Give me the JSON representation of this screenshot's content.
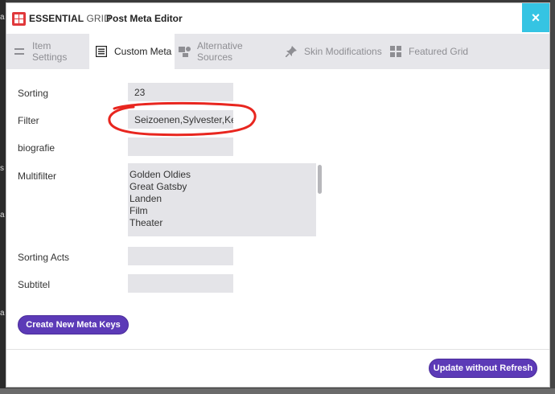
{
  "background": {
    "left_letters": [
      "a",
      "s",
      "a",
      "a"
    ]
  },
  "header": {
    "logo_bold": "ESSENTIAL",
    "logo_light": "GRID",
    "title": "Post Meta Editor",
    "close_symbol": "×"
  },
  "tabs": [
    {
      "label": "Item Settings",
      "icon": "sliders-icon",
      "active": false
    },
    {
      "label": "Custom Meta",
      "icon": "list-icon",
      "active": true
    },
    {
      "label": "Alternative Sources",
      "icon": "media-icon",
      "active": false
    },
    {
      "label": "Skin Modifications",
      "icon": "pin-icon",
      "active": false
    },
    {
      "label": "Featured Grid",
      "icon": "grid-icon",
      "active": false
    }
  ],
  "form": {
    "sorting": {
      "label": "Sorting",
      "value": "23"
    },
    "filter": {
      "label": "Filter",
      "value": "Seizoenen,Sylvester,Kerstmis"
    },
    "biografie": {
      "label": "biografie",
      "value": ""
    },
    "multifilter": {
      "label": "Multifilter",
      "options": [
        "Golden Oldies",
        "Great Gatsby",
        "Landen",
        "Film",
        "Theater"
      ]
    },
    "sorting_acts": {
      "label": "Sorting Acts",
      "value": ""
    },
    "subtitel": {
      "label": "Subtitel",
      "value": ""
    }
  },
  "buttons": {
    "create_meta": "Create New Meta Keys",
    "update": "Update without Refresh"
  },
  "colors": {
    "brand_red": "#e0383b",
    "close_cyan": "#35c4e3",
    "button_purple": "#5c3ab7",
    "annotation_red": "#e8261f"
  }
}
